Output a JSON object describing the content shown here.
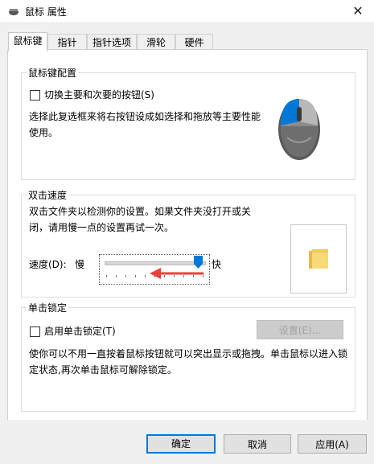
{
  "window": {
    "title": "鼠标 属性"
  },
  "tabs": [
    {
      "label": "鼠标键"
    },
    {
      "label": "指针"
    },
    {
      "label": "指针选项"
    },
    {
      "label": "滑轮"
    },
    {
      "label": "硬件"
    }
  ],
  "button_config": {
    "group_title": "鼠标键配置",
    "switch_label": "切换主要和次要的按钮(S)",
    "switch_checked": false,
    "description": "选择此复选框来将右按钮设成如选择和拖放等主要性能使用。"
  },
  "double_click": {
    "group_title": "双击速度",
    "description": "双击文件夹以检测你的设置。如果文件夹没打开或关闭，请用慢一点的设置再试一次。",
    "speed_label": "速度(D):",
    "slow_label": "慢",
    "fast_label": "快",
    "speed_fraction": 1.0
  },
  "click_lock": {
    "group_title": "单击锁定",
    "enable_label": "启用单击锁定(T)",
    "enable_checked": false,
    "settings_button": "设置(E)...",
    "description": "使你可以不用一直按着鼠标按钮就可以突出显示或拖拽。单击鼠标以进入锁定状态,再次单击鼠标可解除锁定。"
  },
  "footer": {
    "ok": "确定",
    "cancel": "取消",
    "apply": "应用(A)"
  },
  "colors": {
    "accent": "#0078d7",
    "annotation_arrow": "#e8413b"
  }
}
